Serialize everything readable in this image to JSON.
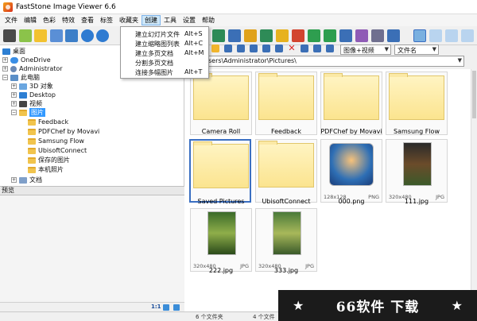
{
  "window": {
    "title": "FastStone Image Viewer 6.6"
  },
  "menu": {
    "items": [
      "文件",
      "编辑",
      "色彩",
      "特效",
      "查看",
      "标签",
      "收藏夹",
      "创建",
      "工具",
      "设置",
      "帮助"
    ],
    "active": "创建",
    "create_dropdown": [
      {
        "label": "建立幻灯片文件",
        "shortcut": "Alt+S"
      },
      {
        "label": "建立缩略图列表",
        "shortcut": "Alt+C"
      },
      {
        "label": "建立多页文档",
        "shortcut": "Alt+M"
      },
      {
        "label": "分割多页文档",
        "shortcut": ""
      },
      {
        "label": "连接多幅图片",
        "shortcut": "Alt+T"
      }
    ]
  },
  "toolbar": {
    "filter_select": "图像+视频",
    "sort_select": "文件名"
  },
  "address": {
    "path": "sers\\Administrator\\Pictures\\"
  },
  "tree": {
    "desktop": "桌面",
    "onedrive": "OneDrive",
    "administrator": "Administrator",
    "this_pc": "此电脑",
    "objects3d": "3D 对象",
    "desktop_en": "Desktop",
    "video": "视频",
    "pictures": "图片",
    "sub": [
      "Feedback",
      "PDFChef by Movavi",
      "Samsung Flow",
      "UbisoftConnect",
      "保存的图片",
      "本机照片"
    ],
    "documents": "文档"
  },
  "preview": {
    "label": "预览",
    "ratio": "1:1"
  },
  "thumbnails": [
    {
      "name": "Camera Roll",
      "type": "folder"
    },
    {
      "name": "Feedback",
      "type": "folder"
    },
    {
      "name": "PDFChef by Movavi",
      "type": "folder"
    },
    {
      "name": "Samsung Flow",
      "type": "folder"
    },
    {
      "name": "Saved Pictures",
      "type": "folder"
    },
    {
      "name": "UbisoftConnect",
      "type": "folder"
    },
    {
      "name": "000.png",
      "type": "image",
      "dims": "128x128",
      "format": "PNG"
    },
    {
      "name": "111.jpg",
      "type": "image",
      "dims": "320x480",
      "format": "JPG"
    },
    {
      "name": "222.jpg",
      "type": "image",
      "dims": "320x480",
      "format": "JPG"
    },
    {
      "name": "333.jpg",
      "type": "image",
      "dims": "320x480",
      "format": "JPG"
    }
  ],
  "status": {
    "folders": "6 个文件夹",
    "files": "4 个文件"
  },
  "watermark": {
    "text": "66软件 下载",
    "star": "★"
  },
  "colors": {
    "selection": "#3399ff",
    "accent": "#3a6fc2"
  }
}
